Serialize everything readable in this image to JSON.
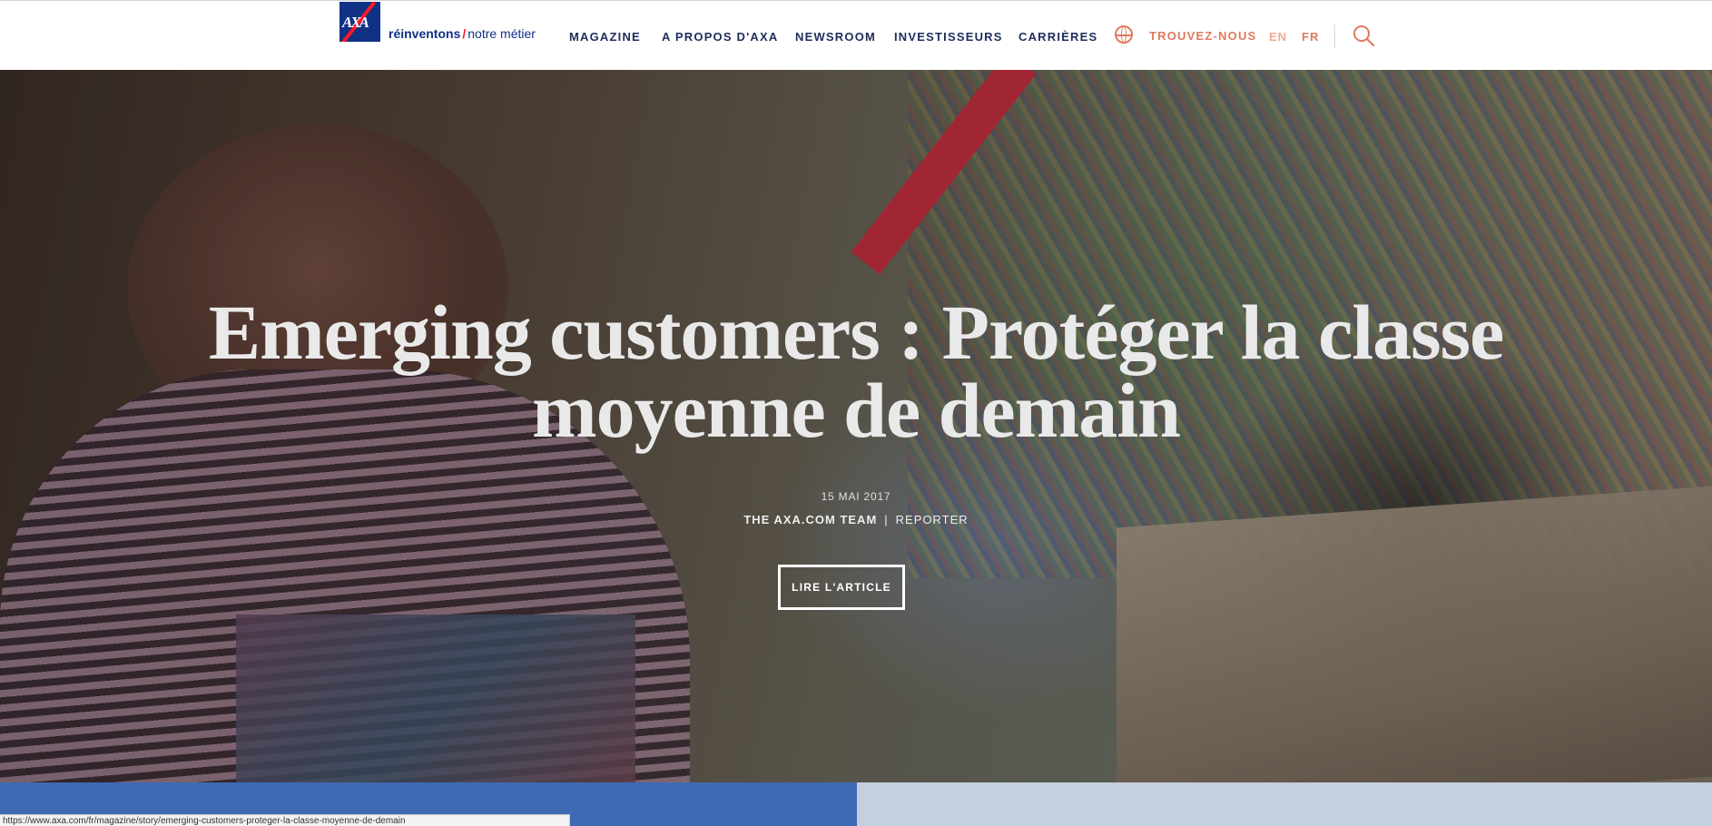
{
  "header": {
    "logo_text": "AXA",
    "tagline_bold": "réinventons",
    "tagline_slash": "/",
    "tagline_rest": "notre métier",
    "nav": [
      "MAGAZINE",
      "A PROPOS D'AXA",
      "NEWSROOM",
      "INVESTISSEURS",
      "CARRIÈRES"
    ],
    "find_us": "TROUVEZ-NOUS",
    "lang_en": "EN",
    "lang_fr": "FR",
    "icons": [
      "globe-icon",
      "search-icon"
    ]
  },
  "hero": {
    "title": "Emerging customers : Protéger la classe moyenne de demain",
    "date": "15 MAI 2017",
    "author": "THE AXA.COM TEAM",
    "separator": "|",
    "role": "REPORTER",
    "cta": "LIRE L'ARTICLE"
  },
  "status_bar": {
    "url": "https://www.axa.com/fr/magazine/story/emerging-customers-proteger-la-classe-moyenne-de-demain"
  },
  "colors": {
    "brand_blue": "#103184",
    "brand_red": "#ff1721",
    "accent_orange": "#e07a5f",
    "panel_blue": "#3e6ab3",
    "panel_light": "#c4d0de"
  }
}
